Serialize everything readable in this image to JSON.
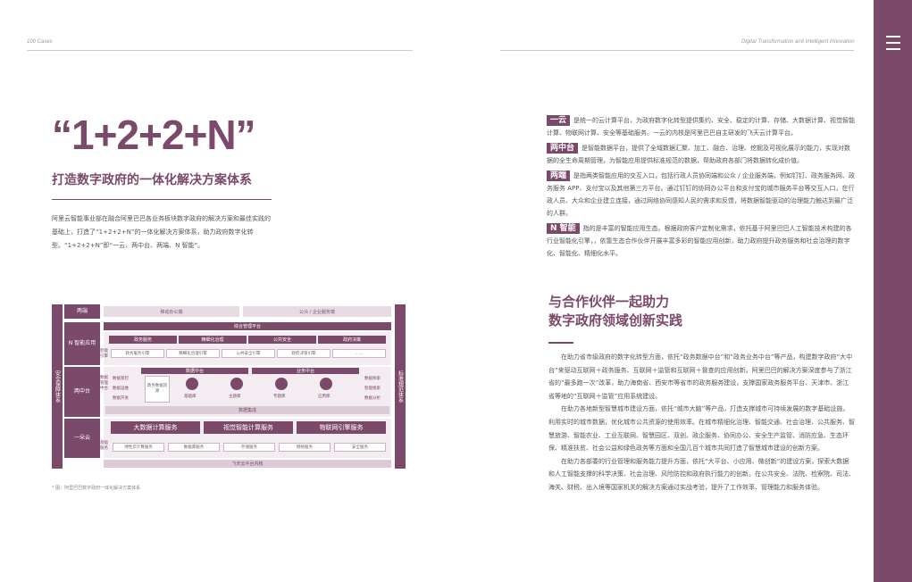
{
  "header": {
    "left": "100 Cases",
    "right": "Digital Transformation and Intelligent Innovation",
    "page_number": "128"
  },
  "menu_icon": "hamburger-menu-icon",
  "left": {
    "big_title": "“1+2+2+N”",
    "subtitle": "打造数字政府的一体化解决方案体系",
    "intro": "阿里云智能事业部在融合阿里巴巴各业务板块数字政府的解决方案和最佳实践的基础上，打造了“1+2+2+N”的一体化解决方案体系，助力政府数字化转型。“1+2+2+N”即“一云、两中台、两端、N 智能”。",
    "caption": "* 图：阿里巴巴数字政府一体化解决方案体系"
  },
  "diagram": {
    "left_label": "安全保障体系",
    "right_label": "标准规范体系",
    "rows": {
      "two_ends": "两端",
      "n_smart": "N 智能应用",
      "two_platforms": "两中台",
      "one_cloud": "一朵云"
    },
    "ends": [
      "移动办公端",
      "公众 / 企业服务端"
    ],
    "platform_bar": "综合管理平台",
    "smart_apps": [
      "政务服务",
      "精细化治理",
      "公共安全",
      "政府决策"
    ],
    "smart_engine_label": "智能引擎",
    "engines": [
      "政务服务引擎",
      "精细化治理引擎",
      "公共安全引擎",
      "政府决策引擎",
      "……"
    ],
    "data_mid": "数据中台",
    "biz_mid": "业务中台",
    "left_tools_label": "数据管理中台",
    "left_tools": [
      "数据管控",
      "数据运维",
      "数据开发"
    ],
    "mid_label": "政务数据资源",
    "mid_icons": [
      "基础库",
      "主题库",
      "专题库",
      "应用库"
    ],
    "right_tools": [
      "数据探索",
      "智能搜索",
      "数据分析"
    ],
    "integration": "数据集成",
    "cloud_services": [
      "大数据计算服务",
      "视觉智能计算服务",
      "物联网引擎服务"
    ],
    "base_label": "基础服务",
    "base_services": [
      "弹性云计算服务",
      "数据库服务",
      "存储服务",
      "网络服务",
      "安全服务"
    ],
    "os": "飞天云平台内核"
  },
  "right": {
    "defs": [
      {
        "tag": "一云",
        "text": "是统一的云计算平台，为政府数字化转型提供集约、安全、稳定的计算、存储、大数据计算、视觉智能计算、物联网计算、安全等基础服务。一云的内核是阿里巴巴自主研发的飞天云计算平台。"
      },
      {
        "tag": "两中台",
        "text": "是智能数据平台，提供了全域数据汇聚、加工、融合、治理、挖掘及可视化展示的能力，实现对数据的全生命周期管理，为智能应用提供标准规范的数据，帮助政府各部门将数据转化成价值。"
      },
      {
        "tag": "两端",
        "text": "是指两类智能应用的交互入口，包括行政人员协同端和公众 / 企业服务端，例如钉钉、政务服务网、政务服务 APP、支付宝以及其他第三方平台。通过钉钉的协同办公平台和支付宝的城市服务平台等交互入口，在行政人员、大众和企业建立连接，通过网络协同感知人民的需求和反馈，将数据智能驱动的治理能力触达到最广泛的人群。"
      },
      {
        "tag": "N 智能",
        "text": "指的是丰富的智能应用生态。根据政府客户定制化需求，依托基于阿里巴巴人工智能技术构建的各行业智能化引擎，，依靠生态合作伙伴开展丰富多彩的智能应用创新，助力政府提升政务服务和社会治理的数字化、智能化、精细化水平。"
      }
    ],
    "section_title_1": "与合作伙伴一起助力",
    "section_title_2": "数字政府领域创新实践",
    "paragraphs": [
      "在助力省市级政府的数字化转型方面，依托“政务数据中台”和“政务业务中台”等产品，构建数字政府“大中台”来驱动互联网＋政务服务、互联网＋监管和互联网＋督查的应用创新。阿里巴巴的解决方案深度参与了浙江省的“最多跑一次”改革，助力海南省、西安市等省市的政务服务建设，支撑国家政务服务平台、天津市、浙江省等地的“互联网＋监管”应用系统建设。",
      "在助力各地新型智慧城市建设方面，依托“城市大脑”等产品，打造支撑城市可持续发展的数字基础设施，利用实时的城市数据，优化城市公共资源的使用效率。在城市精细化治理、智能交通、社会治理、公共服务、智慧旅游、智能农业、工业互联网、智慧园区、双创、政企服务、协同办公、安全生产监管、消防应急、生态环保、精准扶贫、社会公益和绿色政务等方面和全国几百个城市共同打造了智慧城市建设的创新方案。",
      "在助力各部委的行业管理和服务能力提升方面，依托“大平台、小应用、微创新”的建设方案，探索大数据和人工智能支撑的科学决策、社会治理、风险防控和政府执行能力的创新。在公共安全、法院、检察院、司法、海关、财税、出入境等国家机关的解决方案通过实战考验，提升了工作效率、管理能力和服务体验。"
    ]
  },
  "colors": {
    "accent": "#7b4a6a",
    "light": "#e7dce3"
  }
}
